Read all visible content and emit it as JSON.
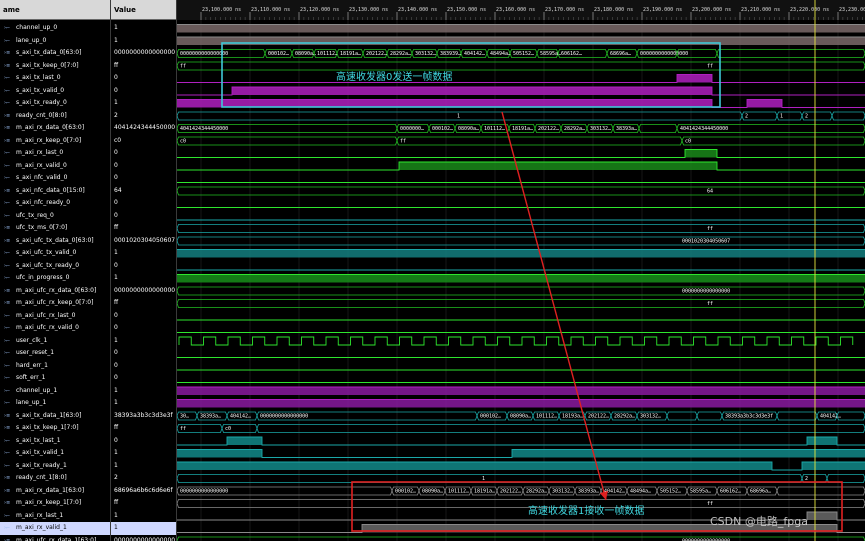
{
  "header": {
    "name_col": "ame",
    "value_col": "Value"
  },
  "ruler_labels": [
    "23,100.000 ns",
    "23,110.000 ns",
    "23,120.000 ns",
    "23,130.000 ns",
    "23,140.000 ns",
    "23,150.000 ns",
    "23,160.000 ns",
    "23,170.000 ns",
    "23,180.000 ns",
    "23,190.000 ns",
    "23,200.000 ns",
    "23,210.000 ns",
    "23,220.000 ns",
    "23,230.000 ns"
  ],
  "signals": [
    {
      "name": "channel_up_0",
      "value": "1",
      "type": "bit",
      "icon": "bit-icon"
    },
    {
      "name": "lane_up_0",
      "value": "1",
      "type": "bit",
      "icon": "bit-icon"
    },
    {
      "name": "s_axi_tx_data_0[63:0]",
      "value": "0000000000000000",
      "type": "bus",
      "icon": "bus-icon"
    },
    {
      "name": "s_axi_tx_keep_0[7:0]",
      "value": "ff",
      "type": "bus",
      "icon": "bus-icon"
    },
    {
      "name": "s_axi_tx_last_0",
      "value": "0",
      "type": "bit",
      "icon": "bit-icon"
    },
    {
      "name": "s_axi_tx_valid_0",
      "value": "0",
      "type": "bit",
      "icon": "bit-icon"
    },
    {
      "name": "s_axi_tx_ready_0",
      "value": "1",
      "type": "bit",
      "icon": "bit-icon"
    },
    {
      "name": "ready_cnt_0[8:0]",
      "value": "2",
      "type": "bus",
      "icon": "bus-icon"
    },
    {
      "name": "m_axi_rx_data_0[63:0]",
      "value": "4041424344450000",
      "type": "bus",
      "icon": "bus-icon"
    },
    {
      "name": "m_axi_rx_keep_0[7:0]",
      "value": "c0",
      "type": "bus",
      "icon": "bus-icon"
    },
    {
      "name": "m_axi_rx_last_0",
      "value": "0",
      "type": "bit",
      "icon": "bit-icon"
    },
    {
      "name": "m_axi_rx_valid_0",
      "value": "0",
      "type": "bit",
      "icon": "bit-icon"
    },
    {
      "name": "s_axi_nfc_valid_0",
      "value": "0",
      "type": "bit",
      "icon": "bit-icon"
    },
    {
      "name": "s_axi_nfc_data_0[15:0]",
      "value": "64",
      "type": "bus",
      "icon": "bus-icon"
    },
    {
      "name": "s_axi_nfc_ready_0",
      "value": "0",
      "type": "bit",
      "icon": "bit-icon"
    },
    {
      "name": "ufc_tx_req_0",
      "value": "0",
      "type": "bit",
      "icon": "bit-icon"
    },
    {
      "name": "ufc_tx_ms_0[7:0]",
      "value": "ff",
      "type": "bus",
      "icon": "bus-icon"
    },
    {
      "name": "s_axi_ufc_tx_data_0[63:0]",
      "value": "0001020304050607",
      "type": "bus",
      "icon": "bus-icon"
    },
    {
      "name": "s_axi_ufc_tx_valid_0",
      "value": "1",
      "type": "bit",
      "icon": "bit-icon"
    },
    {
      "name": "s_axi_ufc_tx_ready_0",
      "value": "0",
      "type": "bit",
      "icon": "bit-icon"
    },
    {
      "name": "ufc_in_progress_0",
      "value": "1",
      "type": "bit",
      "icon": "bit-icon"
    },
    {
      "name": "m_axi_ufc_rx_data_0[63:0]",
      "value": "0000000000000000",
      "type": "bus",
      "icon": "bus-icon"
    },
    {
      "name": "m_axi_ufc_rx_keep_0[7:0]",
      "value": "ff",
      "type": "bus",
      "icon": "bus-icon"
    },
    {
      "name": "m_axi_ufc_rx_last_0",
      "value": "0",
      "type": "bit",
      "icon": "bit-icon"
    },
    {
      "name": "m_axi_ufc_rx_valid_0",
      "value": "0",
      "type": "bit",
      "icon": "bit-icon"
    },
    {
      "name": "user_clk_1",
      "value": "1",
      "type": "bit",
      "icon": "bit-icon"
    },
    {
      "name": "user_reset_1",
      "value": "0",
      "type": "bit",
      "icon": "bit-icon"
    },
    {
      "name": "hard_err_1",
      "value": "0",
      "type": "bit",
      "icon": "bit-icon"
    },
    {
      "name": "soft_err_1",
      "value": "0",
      "type": "bit",
      "icon": "bit-icon"
    },
    {
      "name": "channel_up_1",
      "value": "1",
      "type": "bit",
      "icon": "bit-icon"
    },
    {
      "name": "lane_up_1",
      "value": "1",
      "type": "bit",
      "icon": "bit-icon"
    },
    {
      "name": "s_axi_tx_data_1[63:0]",
      "value": "38393a3b3c3d3e3f",
      "type": "bus",
      "icon": "bus-icon"
    },
    {
      "name": "s_axi_tx_keep_1[7:0]",
      "value": "ff",
      "type": "bus",
      "icon": "bus-icon"
    },
    {
      "name": "s_axi_tx_last_1",
      "value": "0",
      "type": "bit",
      "icon": "bit-icon"
    },
    {
      "name": "s_axi_tx_valid_1",
      "value": "1",
      "type": "bit",
      "icon": "bit-icon"
    },
    {
      "name": "s_axi_tx_ready_1",
      "value": "1",
      "type": "bit",
      "icon": "bit-icon"
    },
    {
      "name": "ready_cnt_1[8:0]",
      "value": "2",
      "type": "bus",
      "icon": "bus-icon"
    },
    {
      "name": "m_axi_rx_data_1[63:0]",
      "value": "68696a6b6c6d6e6f",
      "type": "bus",
      "icon": "bus-icon"
    },
    {
      "name": "m_axi_rx_keep_1[7:0]",
      "value": "ff",
      "type": "bus",
      "icon": "bus-icon"
    },
    {
      "name": "m_axi_rx_last_1",
      "value": "1",
      "type": "bit",
      "icon": "bit-icon"
    },
    {
      "name": "m_axi_rx_valid_1",
      "value": "1",
      "type": "bit",
      "icon": "bit-icon",
      "selected": true
    },
    {
      "name": "m_axi_ufc_rx_data_1[63:0]",
      "value": "0000000000000000",
      "type": "bus",
      "icon": "bus-icon"
    }
  ],
  "wave_labels": {
    "s_axi_tx_data_0": [
      "0000000000000000",
      "000102…",
      "08090a…",
      "101112…",
      "18191a…",
      "202122…",
      "28292a…",
      "303132…",
      "383939…",
      "404142…",
      "48494a…",
      "505152…",
      "58595a…",
      "606162…",
      "68696a…"
    ],
    "s_axi_tx_keep_0": "ff",
    "ready_cnt_0": [
      "1",
      "2",
      "1",
      "2"
    ],
    "m_axi_rx_data_0": [
      "4041424344450000",
      "0000000…",
      "000102…",
      "08090a…",
      "101112…",
      "18191a…",
      "202122…",
      "28292a…",
      "303132…",
      "38393a…",
      "4041424344450000"
    ],
    "m_axi_rx_keep_0": [
      "c0",
      "ff",
      "c0"
    ],
    "s_axi_nfc_data_0": "64",
    "ufc_tx_ms_0": "ff",
    "s_axi_ufc_tx_data_0": "0001020304050607",
    "m_axi_ufc_rx_data_0": "0000000000000000",
    "m_axi_ufc_rx_keep_0": "ff",
    "s_axi_tx_data_1": [
      "30…",
      "38393a…",
      "404142…",
      "0000000000000000",
      "000102…",
      "08090a…",
      "101112…",
      "18193a…",
      "202122…",
      "28292a…",
      "303132…",
      "38393a3b3c3d3e3f",
      "404142…"
    ],
    "s_axi_tx_keep_1": [
      "ff",
      "c0",
      "ff"
    ],
    "ready_cnt_1": [
      "1",
      "2"
    ],
    "m_axi_rx_data_1": [
      "0000000000000000",
      "000102…",
      "08090a…",
      "101112…",
      "18191a…",
      "202122…",
      "28292a…",
      "303132…",
      "38393a…",
      "404142…",
      "48494a…",
      "505152…",
      "58595a…",
      "606162…",
      "68696a…"
    ],
    "m_axi_rx_keep_1": "ff",
    "m_axi_ufc_rx_data_1": "0000000000000000"
  },
  "annotations": {
    "send_label": "高速收发器0发送一帧数据",
    "recv_label": "高速收发器1接收一帧数据"
  },
  "watermark": "CSDN @电路_fpga",
  "colors": {
    "bit_green": "#2ee62e",
    "bus_green": "#22c022",
    "magenta": "#b020c0",
    "teal": "#1aa8a8",
    "grey": "#8a8a8a",
    "cyan_box": "#3fc8d8",
    "red_box": "#e02020",
    "cursor": "#e6e640"
  }
}
